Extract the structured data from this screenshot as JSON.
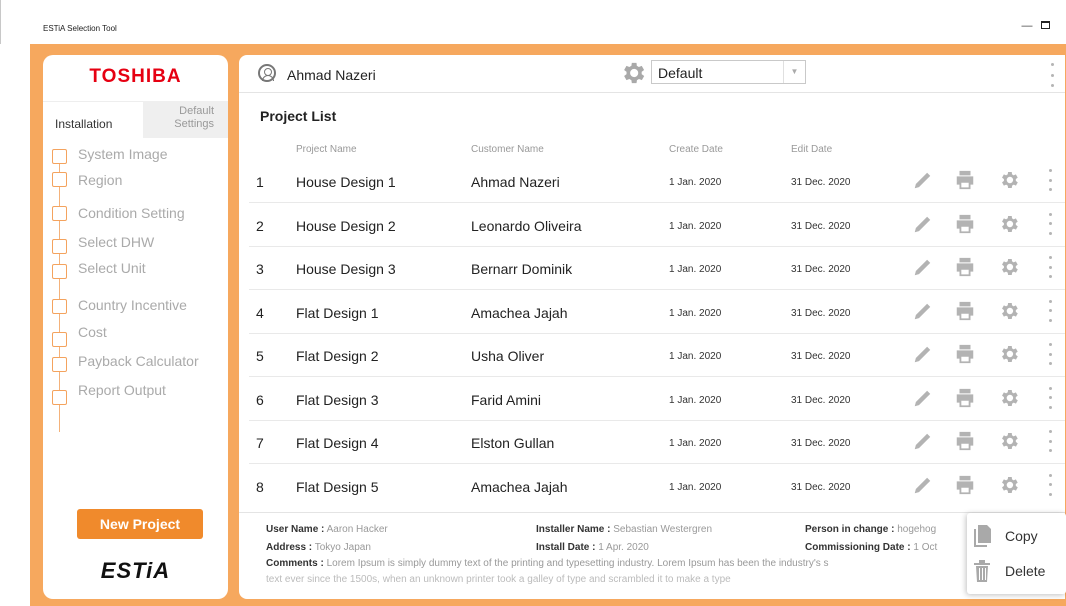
{
  "window": {
    "title": "ESTiA Selection Tool",
    "minimize_glyph": "—"
  },
  "sidebar": {
    "brand": "TOSHIBA",
    "tabs": {
      "installation": "Installation",
      "default_settings": "Default Settings"
    },
    "steps": [
      {
        "label": "System Image"
      },
      {
        "label": "Region"
      },
      {
        "label": "Condition Setting"
      },
      {
        "label": "Select DHW"
      },
      {
        "label": "Select Unit"
      },
      {
        "label": "Country Incentive"
      },
      {
        "label": "Cost"
      },
      {
        "label": "Payback Calculator"
      },
      {
        "label": "Report Output"
      }
    ],
    "new_project": "New Project",
    "product_logo": "ESTiA"
  },
  "header": {
    "user_name": "Ahmad Nazeri",
    "preset_select": "Default"
  },
  "project_list": {
    "title": "Project List",
    "columns": {
      "project_name": "Project Name",
      "customer_name": "Customer Name",
      "create_date": "Create Date",
      "edit_date": "Edit Date"
    },
    "rows": [
      {
        "num": "1",
        "project": "House Design 1",
        "customer": "Ahmad Nazeri",
        "created": "1 Jan. 2020",
        "edited": "31 Dec. 2020"
      },
      {
        "num": "2",
        "project": "House Design 2",
        "customer": "Leonardo Oliveira",
        "created": "1 Jan. 2020",
        "edited": "31 Dec. 2020"
      },
      {
        "num": "3",
        "project": "House Design 3",
        "customer": "Bernarr Dominik",
        "created": "1 Jan. 2020",
        "edited": "31 Dec. 2020"
      },
      {
        "num": "4",
        "project": "Flat Design 1",
        "customer": "Amachea Jajah",
        "created": "1 Jan. 2020",
        "edited": "31 Dec. 2020"
      },
      {
        "num": "5",
        "project": "Flat Design 2",
        "customer": "Usha Oliver",
        "created": "1 Jan. 2020",
        "edited": "31 Dec. 2020"
      },
      {
        "num": "6",
        "project": "Flat Design 3",
        "customer": "Farid Amini",
        "created": "1 Jan. 2020",
        "edited": "31 Dec. 2020"
      },
      {
        "num": "7",
        "project": "Flat Design 4",
        "customer": "Elston Gullan",
        "created": "1 Jan. 2020",
        "edited": "31 Dec. 2020"
      },
      {
        "num": "8",
        "project": "Flat Design 5",
        "customer": "Amachea Jajah",
        "created": "1 Jan. 2020",
        "edited": "31 Dec. 2020"
      }
    ]
  },
  "details": {
    "user_name_label": "User Name :",
    "user_name_value": "Aaron Hacker",
    "installer_label": "Installer Name :",
    "installer_value": "Sebastian Westergren",
    "person_label": "Person in change :",
    "person_value": "hogehog",
    "address_label": "Address :",
    "address_value": "Tokyo Japan",
    "install_date_label": "Install Date :",
    "install_date_value": "1 Apr. 2020",
    "commissioning_label": "Commissioning Date :",
    "commissioning_value": "1 Oct",
    "comments_label": "Comments :",
    "comments_value": "Lorem Ipsum is simply dummy text of the printing and typesetting industry. Lorem Ipsum has been the industry's s",
    "comments_line2": "text ever since the 1500s, when an unknown printer took a galley of type and scrambled it to make a type"
  },
  "context_menu": {
    "copy": "Copy",
    "delete": "Delete"
  },
  "colors": {
    "accent": "#f08a2c",
    "frame": "#f6a85e",
    "brand_red": "#e60012"
  }
}
